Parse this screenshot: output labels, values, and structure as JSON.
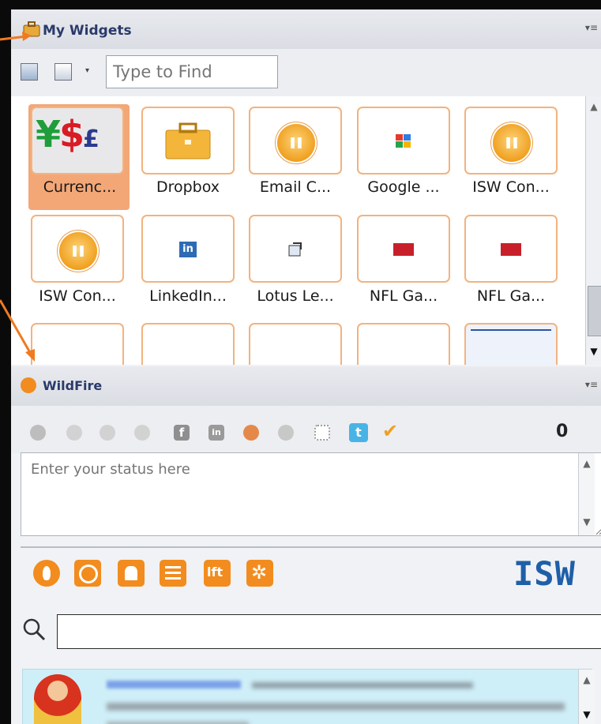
{
  "widgets_panel": {
    "title": "My Widgets",
    "search_placeholder": "Type to Find",
    "items": [
      {
        "label": "Currenc...",
        "icon": "currency-icon",
        "selected": true
      },
      {
        "label": "Dropbox",
        "icon": "briefcase-icon"
      },
      {
        "label": "Email C...",
        "icon": "isw-logo-icon"
      },
      {
        "label": "Google ...",
        "icon": "google-icon"
      },
      {
        "label": "ISW Con...",
        "icon": "isw-logo-icon"
      },
      {
        "label": "ISW Con...",
        "icon": "isw-logo-icon"
      },
      {
        "label": "LinkedIn...",
        "icon": "linkedin-icon"
      },
      {
        "label": "Lotus Le...",
        "icon": "lotus-icon"
      },
      {
        "label": "NFL Ga...",
        "icon": "nfl-icon"
      },
      {
        "label": "NFL Ga...",
        "icon": "nfl-icon"
      }
    ]
  },
  "wildfire_panel": {
    "title": "WildFire",
    "count": "0",
    "status_placeholder": "Enter your status here",
    "brand": "ISW",
    "colors": {
      "accent": "#f28c1e",
      "brand": "#1f5fa8",
      "tile_border": "#f2b37f"
    }
  }
}
